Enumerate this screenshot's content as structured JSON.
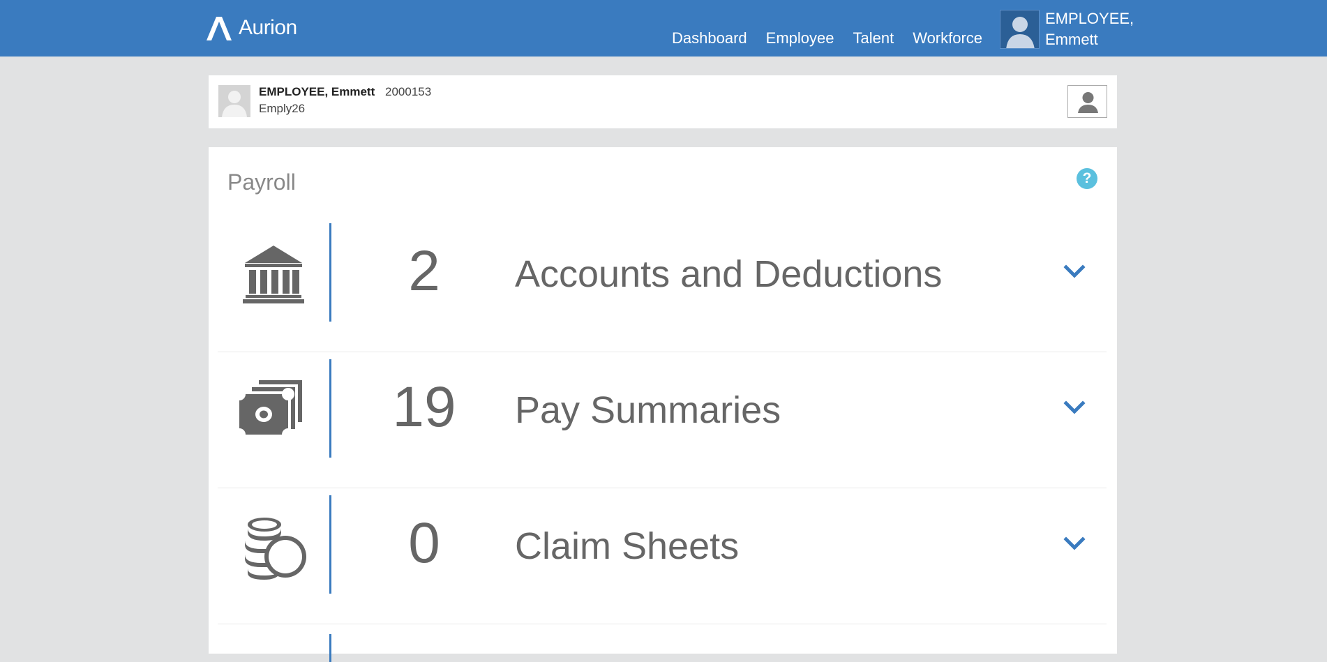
{
  "header": {
    "brand": "Aurion",
    "nav": [
      {
        "label": "Dashboard"
      },
      {
        "label": "Employee"
      },
      {
        "label": "Talent"
      },
      {
        "label": "Workforce"
      }
    ],
    "user": {
      "line1": "EMPLOYEE,",
      "line2": "Emmett"
    }
  },
  "employee": {
    "name": "EMPLOYEE, Emmett",
    "id": "2000153",
    "username": "Emply26"
  },
  "payroll": {
    "title": "Payroll",
    "help_label": "?",
    "rows": [
      {
        "count": "2",
        "label": "Accounts and Deductions",
        "icon": "bank-icon"
      },
      {
        "count": "19",
        "label": "Pay Summaries",
        "icon": "money-stack-icon"
      },
      {
        "count": "0",
        "label": "Claim Sheets",
        "icon": "coins-icon"
      }
    ]
  },
  "colors": {
    "brand_blue": "#3a7bbf",
    "help_blue": "#5bc0de",
    "background": "#e1e2e3"
  }
}
